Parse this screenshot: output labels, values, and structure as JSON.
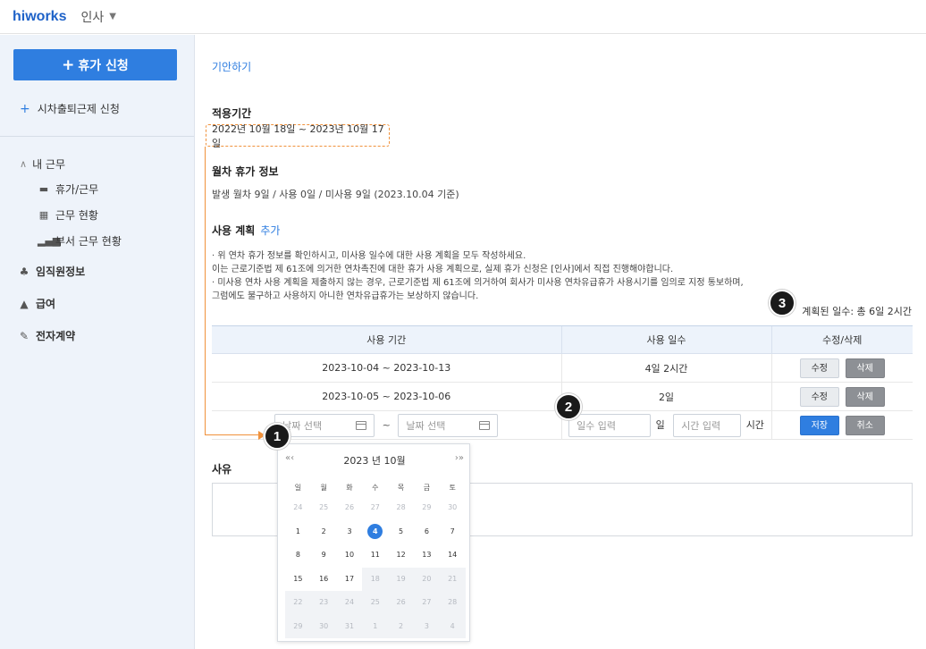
{
  "header": {
    "logo": "hiworks",
    "menu": "인사",
    "caret": "▼"
  },
  "sidebar": {
    "primary_button": "휴가 신청",
    "flex_link": "시차출퇴근제 신청",
    "my_work": "내 근무",
    "items": [
      "휴가/근무",
      "근무 현황",
      "부서 근무 현황"
    ],
    "sections": [
      "임직원정보",
      "급여",
      "전자계약"
    ]
  },
  "main": {
    "draft_link": "기안하기",
    "apply_period_label": "적용기간",
    "apply_period_value": "2022년 10월 18일 ~ 2023년 10월 17일",
    "annual_info_label": "월차 휴가 정보",
    "annual_info_value": "발생 월차 9일 / 사용 0일 / 미사용 9일 (2023.10.04 기준)",
    "plan_label": "사용 계획",
    "plan_add": "추가",
    "notice_lines": [
      "· 위 연차 휴가 정보를 확인하시고, 미사용 일수에 대한 사용 계획을 모두 작성하세요.",
      "이는 근로기준법 제 61조에 의거한 연차촉진에 대한 휴가 사용 계획으로, 실제 휴가 신청은 [인사]에서 직접 진행해야합니다.",
      "· 미사용 연차 사용 계획을 제출하지 않는 경우, 근로기준법 제 61조에 의거하여 회사가 미사용 연차유급휴가 사용시기를 임의로 지정 통보하며,",
      "그럼에도 불구하고 사용하지 아니한 연차유급휴가는 보상하지 않습니다."
    ],
    "planned_days": "계획된 일수: 총 6일 2시간",
    "table": {
      "headers": [
        "사용 기간",
        "사용 일수",
        "수정/삭제"
      ],
      "rows": [
        {
          "period": "2023-10-04 ~ 2023-10-13",
          "days": "4일 2시간"
        },
        {
          "period": "2023-10-05 ~ 2023-10-06",
          "days": "2일"
        }
      ],
      "edit": "수정",
      "delete": "삭제",
      "input_row": {
        "date_placeholder": "날짜 선택",
        "tilde": "~",
        "days_placeholder": "일수 입력",
        "day_unit": "일",
        "hours_placeholder": "시간 입력",
        "hour_unit": "시간",
        "save": "저장",
        "cancel": "취소"
      }
    },
    "reason_label": "사유"
  },
  "calendar": {
    "year_month": "2023 년  10월",
    "prev": "«‹",
    "next": "›»",
    "dow": [
      "일",
      "월",
      "화",
      "수",
      "목",
      "금",
      "토"
    ],
    "weeks": [
      [
        "24",
        "25",
        "26",
        "27",
        "28",
        "29",
        "30"
      ],
      [
        "1",
        "2",
        "3",
        "4",
        "5",
        "6",
        "7"
      ],
      [
        "8",
        "9",
        "10",
        "11",
        "12",
        "13",
        "14"
      ],
      [
        "15",
        "16",
        "17",
        "18",
        "19",
        "20",
        "21"
      ],
      [
        "22",
        "23",
        "24",
        "25",
        "26",
        "27",
        "28"
      ],
      [
        "29",
        "30",
        "31",
        "1",
        "2",
        "3",
        "4"
      ]
    ],
    "today": "4"
  },
  "badges": [
    "1",
    "2",
    "3"
  ],
  "colors": {
    "accent": "#2f7ee0",
    "highlight": "#f0913b",
    "sidebar_bg": "#eef3fa"
  }
}
